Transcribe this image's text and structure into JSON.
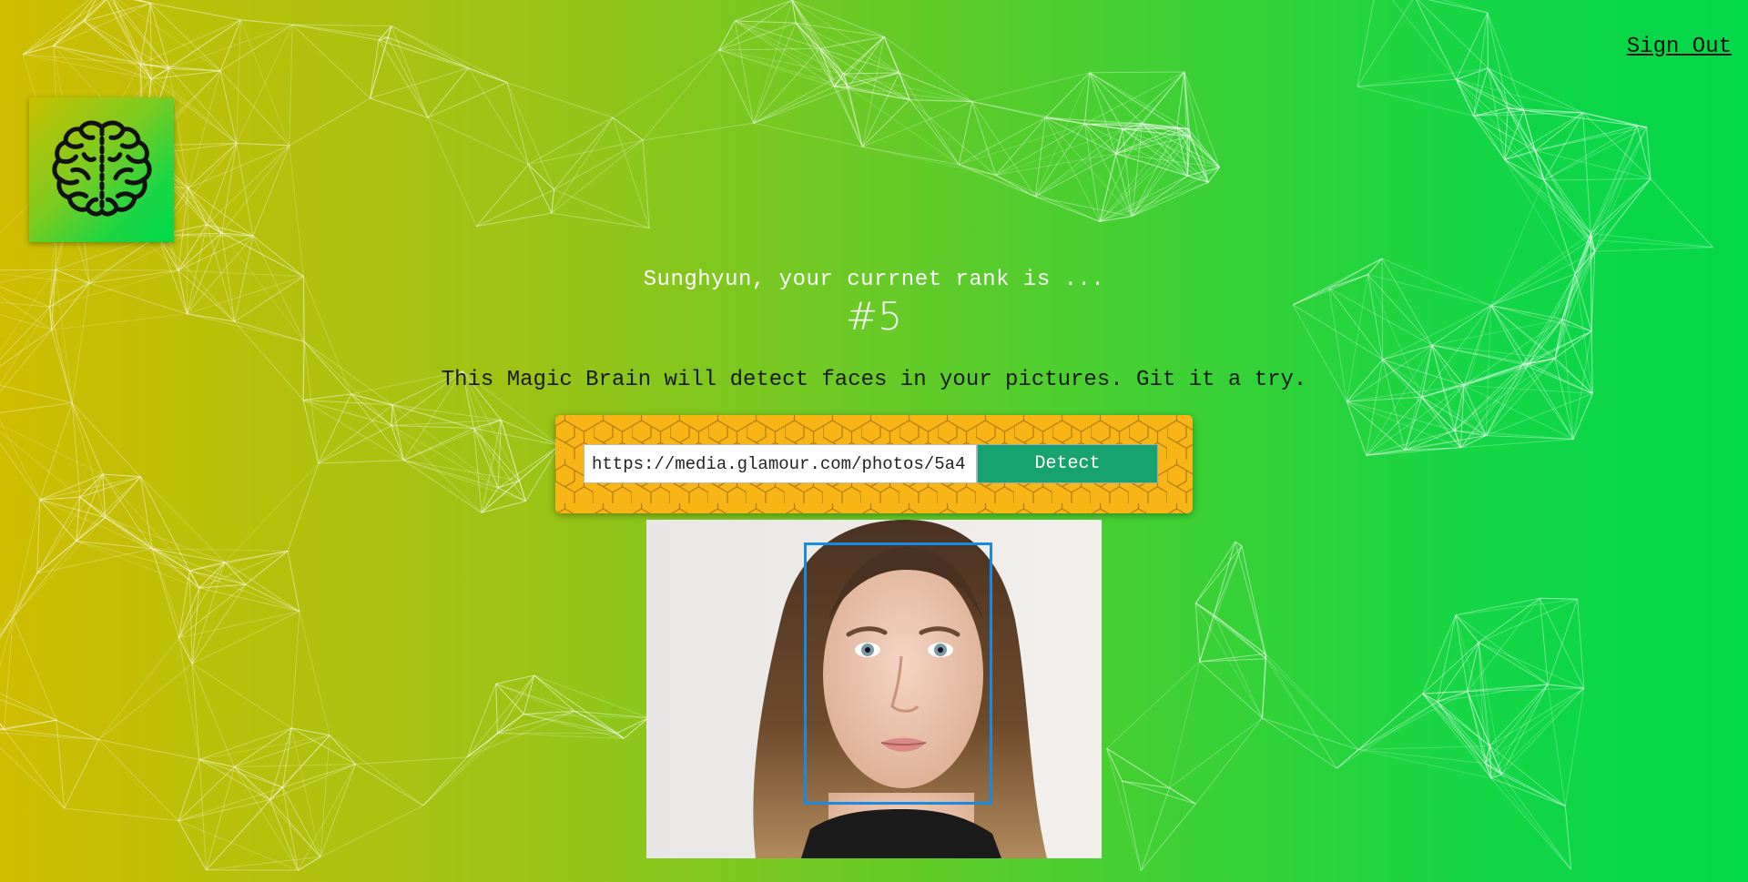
{
  "header": {
    "signout_label": "Sign Out"
  },
  "logo": {
    "icon": "brain-icon"
  },
  "rank": {
    "intro": "Sunghyun, your currnet rank is ...",
    "number": "#5"
  },
  "tagline": "This Magic Brain will detect faces in your pictures. Git it a try.",
  "form": {
    "url_value": "https://media.glamour.com/photos/5a4",
    "detect_label": "Detect"
  },
  "photo": {
    "description_icon": "portrait-photo",
    "face_detected": true
  },
  "colors": {
    "gradient_left": "#cfbd00",
    "gradient_right": "#02d84a",
    "panel": "#f7b616",
    "button": "#17a36f",
    "face_box": "#1a8ae0"
  }
}
